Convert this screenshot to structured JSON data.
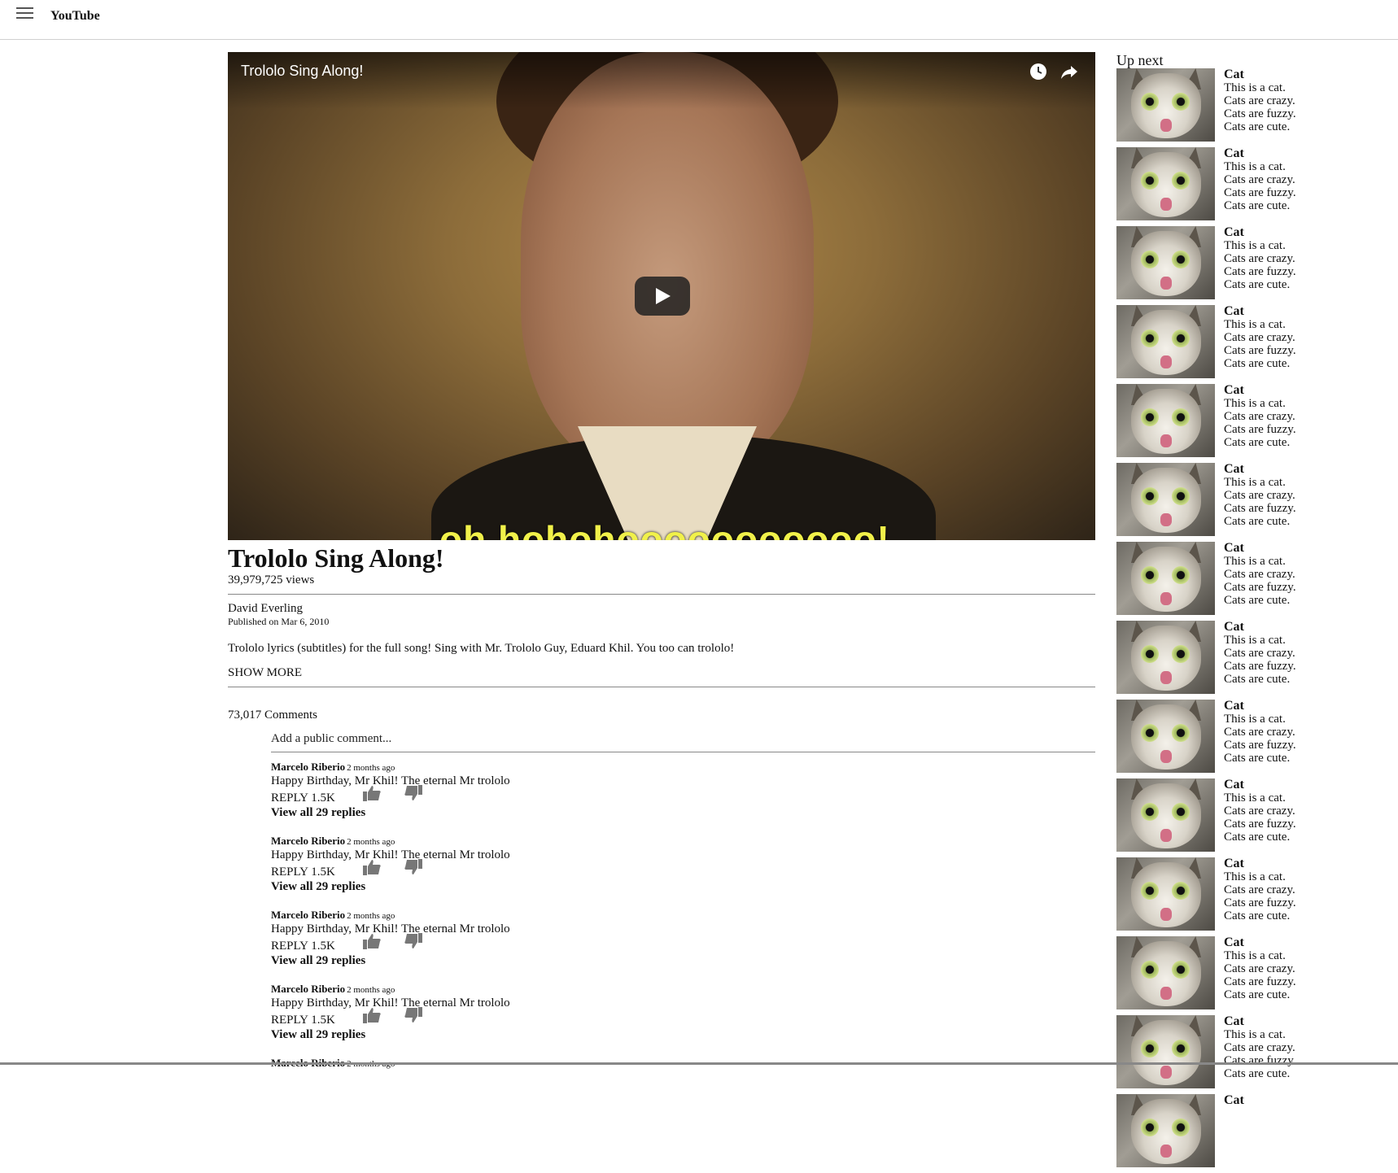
{
  "header": {
    "brand": "YouTube",
    "menu_icon": "hamburger-menu-icon"
  },
  "player": {
    "overlay_title": "Trololo Sing Along!",
    "subtitle": "oh hohohooooooooooo!",
    "icons": [
      "clock-icon",
      "share-icon",
      "play-icon"
    ]
  },
  "video": {
    "title": "Trololo Sing Along!",
    "views": "39,979,725 views",
    "channel": "David Everling",
    "published": "Published on Mar 6, 2010",
    "description": "Trololo lyrics (subtitles) for the full song! Sing with Mr. Trololo Guy, Eduard Khil. You too can trololo!",
    "show_more": "SHOW MORE"
  },
  "comments": {
    "count": "73,017 Comments",
    "placeholder": "Add a public comment...",
    "items": [
      {
        "author": "Marcelo Riberio",
        "time": "2 months ago",
        "text": "Happy Birthday, Mr Khil! The eternal Mr trololo",
        "reply": "REPLY",
        "likes": "1.5K",
        "view_replies": "View all 29 replies"
      },
      {
        "author": "Marcelo Riberio",
        "time": "2 months ago",
        "text": "Happy Birthday, Mr Khil! The eternal Mr trololo",
        "reply": "REPLY",
        "likes": "1.5K",
        "view_replies": "View all 29 replies"
      },
      {
        "author": "Marcelo Riberio",
        "time": "2 months ago",
        "text": "Happy Birthday, Mr Khil! The eternal Mr trololo",
        "reply": "REPLY",
        "likes": "1.5K",
        "view_replies": "View all 29 replies"
      },
      {
        "author": "Marcelo Riberio",
        "time": "2 months ago",
        "text": "Happy Birthday, Mr Khil! The eternal Mr trololo",
        "reply": "REPLY",
        "likes": "1.5K",
        "view_replies": "View all 29 replies"
      },
      {
        "author": "Marcelo Riberio",
        "time": "2 months ago",
        "text": "",
        "reply": "",
        "likes": "",
        "view_replies": ""
      }
    ]
  },
  "sidebar": {
    "heading": "Up next",
    "cards": [
      {
        "title": "Cat",
        "lines": [
          "This is a cat.",
          "Cats are crazy.",
          "Cats are fuzzy.",
          "Cats are cute."
        ]
      },
      {
        "title": "Cat",
        "lines": [
          "This is a cat.",
          "Cats are crazy.",
          "Cats are fuzzy.",
          "Cats are cute."
        ]
      },
      {
        "title": "Cat",
        "lines": [
          "This is a cat.",
          "Cats are crazy.",
          "Cats are fuzzy.",
          "Cats are cute."
        ]
      },
      {
        "title": "Cat",
        "lines": [
          "This is a cat.",
          "Cats are crazy.",
          "Cats are fuzzy.",
          "Cats are cute."
        ]
      },
      {
        "title": "Cat",
        "lines": [
          "This is a cat.",
          "Cats are crazy.",
          "Cats are fuzzy.",
          "Cats are cute."
        ]
      },
      {
        "title": "Cat",
        "lines": [
          "This is a cat.",
          "Cats are crazy.",
          "Cats are fuzzy.",
          "Cats are cute."
        ]
      },
      {
        "title": "Cat",
        "lines": [
          "This is a cat.",
          "Cats are crazy.",
          "Cats are fuzzy.",
          "Cats are cute."
        ]
      },
      {
        "title": "Cat",
        "lines": [
          "This is a cat.",
          "Cats are crazy.",
          "Cats are fuzzy.",
          "Cats are cute."
        ]
      },
      {
        "title": "Cat",
        "lines": [
          "This is a cat.",
          "Cats are crazy.",
          "Cats are fuzzy.",
          "Cats are cute."
        ]
      },
      {
        "title": "Cat",
        "lines": [
          "This is a cat.",
          "Cats are crazy.",
          "Cats are fuzzy.",
          "Cats are cute."
        ]
      },
      {
        "title": "Cat",
        "lines": [
          "This is a cat.",
          "Cats are crazy.",
          "Cats are fuzzy.",
          "Cats are cute."
        ]
      },
      {
        "title": "Cat",
        "lines": [
          "This is a cat.",
          "Cats are crazy.",
          "Cats are fuzzy.",
          "Cats are cute."
        ]
      },
      {
        "title": "Cat",
        "lines": [
          "This is a cat.",
          "Cats are crazy.",
          "Cats are fuzzy.",
          "Cats are cute."
        ]
      },
      {
        "title": "Cat",
        "lines": []
      }
    ]
  }
}
